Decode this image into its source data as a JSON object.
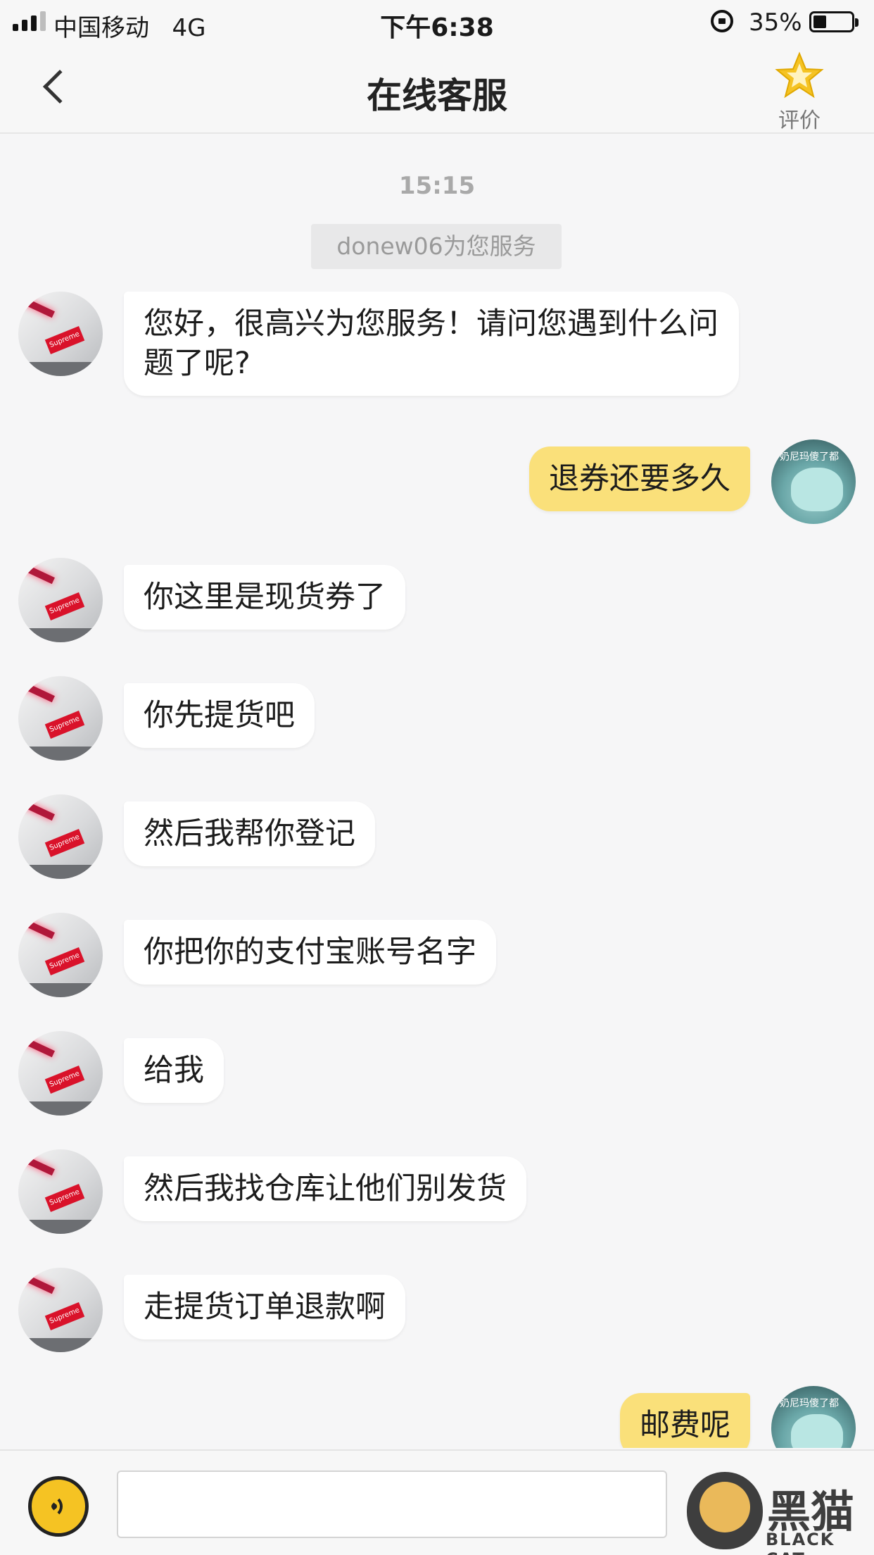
{
  "status_bar": {
    "carrier": "中国移动",
    "network": "4G",
    "time": "下午6:38",
    "battery_percent": "35%",
    "battery_level": 0.35,
    "signal_bars": 3
  },
  "nav": {
    "title": "在线客服",
    "rate_label": "评价",
    "accent_color": "#f5c323"
  },
  "chat": {
    "time_divider": "15:15",
    "system_tip": "donew06为您服务",
    "agent_avatar_text": "Supreme",
    "user_avatar_caption": "奶尼玛傻了都",
    "messages": [
      {
        "side": "agent",
        "text": "您好，很高兴为您服务！请问您遇到什么问题了呢?"
      },
      {
        "side": "user",
        "text": "退券还要多久"
      },
      {
        "side": "agent",
        "text": "你这里是现货券了"
      },
      {
        "side": "agent",
        "text": "你先提货吧"
      },
      {
        "side": "agent",
        "text": "然后我帮你登记"
      },
      {
        "side": "agent",
        "text": "你把你的支付宝账号名字"
      },
      {
        "side": "agent",
        "text": "给我"
      },
      {
        "side": "agent",
        "text": "然后我找仓库让他们别发货"
      },
      {
        "side": "agent",
        "text": "走提货订单退款啊"
      },
      {
        "side": "user",
        "text": "邮费呢"
      }
    ],
    "user_bubble_color": "#fae07a",
    "agent_bubble_color": "#ffffff"
  },
  "input": {
    "value": "",
    "placeholder": ""
  },
  "watermark": {
    "text": "黑猫",
    "sub": "BLACK CAT"
  }
}
